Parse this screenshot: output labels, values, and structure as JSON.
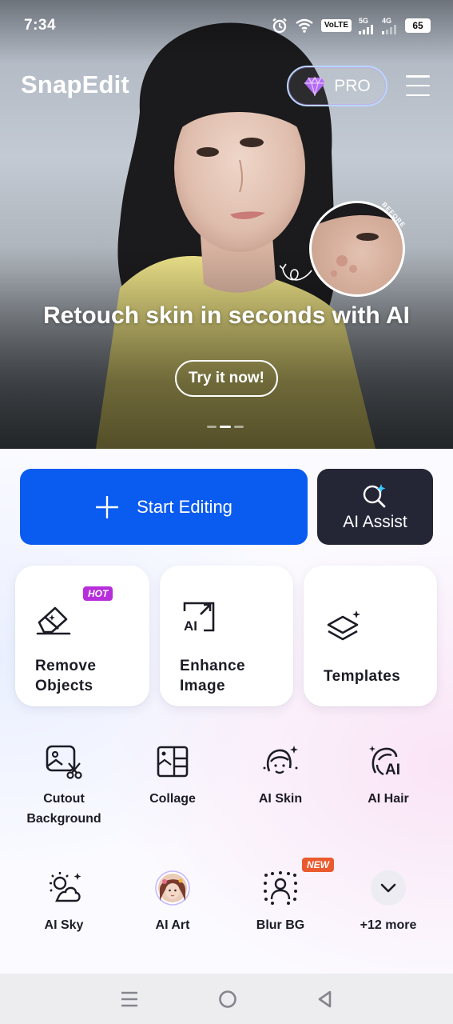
{
  "status_bar": {
    "time": "7:34",
    "volte": "VoLTE",
    "network_5g": "5G",
    "network_4g": "4G",
    "battery": "65"
  },
  "header": {
    "app_title": "SnapEdit",
    "pro_label": "PRO"
  },
  "banner": {
    "heading": "Retouch skin in seconds with AI",
    "cta": "Try it now!",
    "before_label": "BEFORE",
    "slide_count": 3,
    "active_slide": 2
  },
  "actions": {
    "start_editing": "Start Editing",
    "ai_assist": "AI Assist"
  },
  "featured": [
    {
      "label_line1": "Remove",
      "label_line2": "Objects",
      "badge": "HOT"
    },
    {
      "label_line1": "Enhance",
      "label_line2": "Image"
    },
    {
      "label": "Templates"
    }
  ],
  "tools_row1": [
    {
      "label_line1": "Cutout",
      "label_line2": "Background"
    },
    {
      "label": "Collage"
    },
    {
      "label": "AI Skin"
    },
    {
      "label": "AI Hair"
    }
  ],
  "tools_row2": [
    {
      "label": "AI Sky"
    },
    {
      "label": "AI Art"
    },
    {
      "label": "Blur BG",
      "badge": "NEW"
    },
    {
      "label": "+12 more"
    }
  ],
  "colors": {
    "primary": "#0A5BEF",
    "dark_button": "#242636",
    "hot_badge": "#B72DDB",
    "new_badge": "#EA5A2F"
  }
}
